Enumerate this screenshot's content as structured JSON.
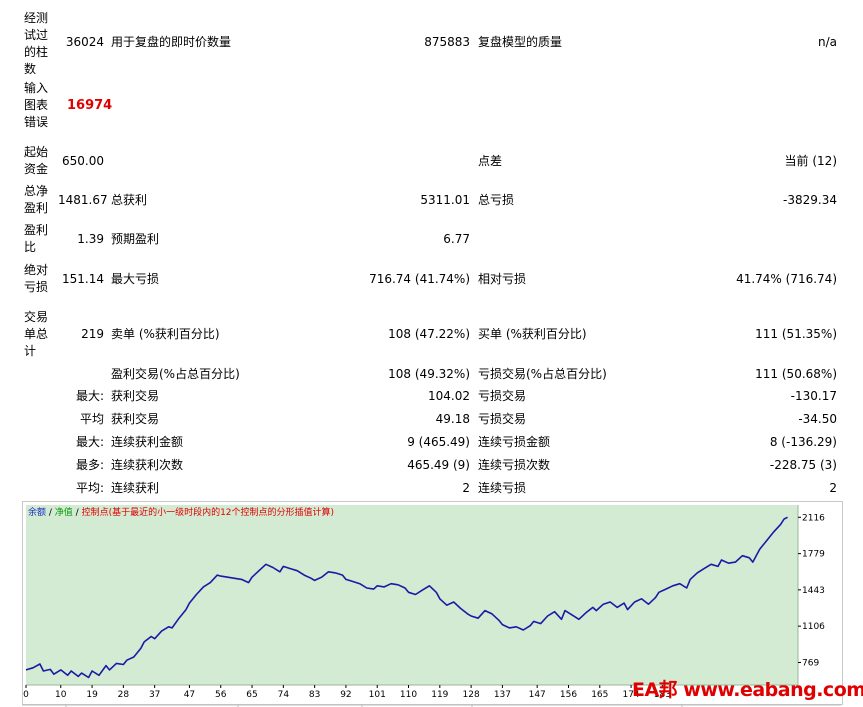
{
  "report": {
    "bars_tested": {
      "label": "经测试过的柱数",
      "value": "36024"
    },
    "ticks_modelled": {
      "label": "用于复盘的即时价数量",
      "value": "875883"
    },
    "modelling_quality": {
      "label": "复盘模型的质量",
      "value": "n/a"
    },
    "mismatched_errors": {
      "label": "输入图表错误",
      "value": "16974"
    },
    "initial_deposit": {
      "label": "起始资金",
      "value": "650.00"
    },
    "spread": {
      "label": "点差",
      "value": "当前 (12)"
    },
    "total_net_profit": {
      "label": "总净盈利",
      "value": "1481.67"
    },
    "gross_profit": {
      "label": "总获利",
      "value": "5311.01"
    },
    "gross_loss": {
      "label": "总亏损",
      "value": "-3829.34"
    },
    "profit_factor": {
      "label": "盈利比",
      "value": "1.39"
    },
    "expected_payoff": {
      "label": "预期盈利",
      "value": "6.77"
    },
    "absolute_drawdown": {
      "label": "绝对亏损",
      "value": "151.14"
    },
    "maximal_drawdown": {
      "label": "最大亏损",
      "value": "716.74 (41.74%)"
    },
    "relative_drawdown": {
      "label": "相对亏损",
      "value": "41.74% (716.74)"
    },
    "total_trades": {
      "label": "交易单总计",
      "value": "219"
    },
    "short_positions": {
      "label": "卖单 (%获利百分比)",
      "value": "108 (47.22%)"
    },
    "long_positions": {
      "label": "买单 (%获利百分比)",
      "value": "111 (51.35%)"
    },
    "profit_trades": {
      "label": "盈利交易(%占总百分比)",
      "value": "108 (49.32%)"
    },
    "loss_trades": {
      "label": "亏损交易(%占总百分比)",
      "value": "111 (50.68%)"
    },
    "largest": {
      "prefix": "最大:",
      "profit_label": "获利交易",
      "profit_value": "104.02",
      "loss_label": "亏损交易",
      "loss_value": "-130.17"
    },
    "average": {
      "prefix": "平均",
      "profit_label": "获利交易",
      "profit_value": "49.18",
      "loss_label": "亏损交易",
      "loss_value": "-34.50"
    },
    "max_consec_amount": {
      "prefix": "最大:",
      "profit_label": "连续获利金额",
      "profit_value": "9 (465.49)",
      "loss_label": "连续亏损金额",
      "loss_value": "8 (-136.29)"
    },
    "max_consec_count": {
      "prefix": "最多:",
      "profit_label": "连续获利次数",
      "profit_value": "465.49 (9)",
      "loss_label": "连续亏损次数",
      "loss_value": "-228.75 (3)"
    },
    "avg_consec": {
      "prefix": "平均:",
      "profit_label": "连续获利",
      "profit_value": "2",
      "loss_label": "连续亏损",
      "loss_value": "2"
    }
  },
  "legend": {
    "balance": "余额",
    "sep1": " / ",
    "equity": "净值",
    "sep2": " / ",
    "checkpoints": "控制点(基于最近的小一级时段内的12个控制点的分形插值计算)"
  },
  "watermark": "EA邦 www.eabang.com",
  "colors": {
    "chart_bg": "#d3ead3",
    "balance_line": "#1a1aa6",
    "grid": "#bcd8bc"
  },
  "chart_data": {
    "type": "line",
    "series": [
      {
        "name": "余额",
        "x": [
          0,
          2,
          4,
          5,
          7,
          8,
          10,
          12,
          13,
          15,
          16,
          18,
          19,
          21,
          23,
          24,
          26,
          28,
          29,
          31,
          33,
          34,
          36,
          37,
          39,
          41,
          42,
          44,
          46,
          47,
          49,
          51,
          53,
          55,
          56,
          58,
          60,
          62,
          64,
          65,
          67,
          69,
          71,
          73,
          74,
          76,
          78,
          80,
          82,
          83,
          85,
          87,
          89,
          91,
          92,
          94,
          96,
          98,
          100,
          101,
          103,
          105,
          107,
          109,
          110,
          112,
          114,
          116,
          118,
          119,
          121,
          123,
          125,
          127,
          128,
          130,
          132,
          134,
          136,
          137,
          139,
          141,
          143,
          145,
          146,
          148,
          150,
          152,
          154,
          155,
          157,
          159,
          161,
          163,
          164,
          166,
          168,
          170,
          172,
          173,
          175,
          177,
          179,
          181,
          182,
          184,
          186,
          188,
          190,
          191,
          193,
          195,
          197,
          199,
          200,
          202,
          204,
          206,
          208,
          209,
          211,
          213,
          215,
          217,
          218,
          219
        ],
        "values": [
          700,
          720,
          755,
          690,
          705,
          660,
          700,
          650,
          690,
          640,
          670,
          630,
          690,
          650,
          740,
          700,
          760,
          750,
          790,
          820,
          900,
          960,
          1010,
          990,
          1060,
          1100,
          1090,
          1180,
          1260,
          1320,
          1400,
          1470,
          1510,
          1580,
          1570,
          1560,
          1550,
          1540,
          1510,
          1560,
          1620,
          1680,
          1650,
          1610,
          1660,
          1640,
          1620,
          1580,
          1550,
          1530,
          1560,
          1610,
          1600,
          1580,
          1540,
          1520,
          1500,
          1460,
          1450,
          1480,
          1470,
          1500,
          1490,
          1460,
          1420,
          1400,
          1440,
          1480,
          1420,
          1360,
          1300,
          1330,
          1270,
          1220,
          1200,
          1180,
          1250,
          1220,
          1160,
          1120,
          1090,
          1100,
          1070,
          1110,
          1150,
          1130,
          1200,
          1240,
          1170,
          1250,
          1210,
          1170,
          1230,
          1280,
          1250,
          1310,
          1330,
          1280,
          1320,
          1260,
          1330,
          1360,
          1310,
          1370,
          1420,
          1450,
          1480,
          1500,
          1460,
          1540,
          1600,
          1640,
          1680,
          1660,
          1720,
          1690,
          1700,
          1760,
          1740,
          1700,
          1820,
          1900,
          1980,
          2050,
          2100,
          2116
        ]
      }
    ],
    "x_ticks": [
      0,
      10,
      19,
      28,
      37,
      47,
      56,
      65,
      74,
      83,
      92,
      101,
      110,
      119,
      128,
      137,
      147,
      156,
      165,
      174,
      183
    ],
    "y_ticks": [
      769,
      1106,
      1443,
      1779,
      2116
    ],
    "xlim": [
      0,
      222
    ],
    "ylim": [
      560,
      2230
    ]
  }
}
